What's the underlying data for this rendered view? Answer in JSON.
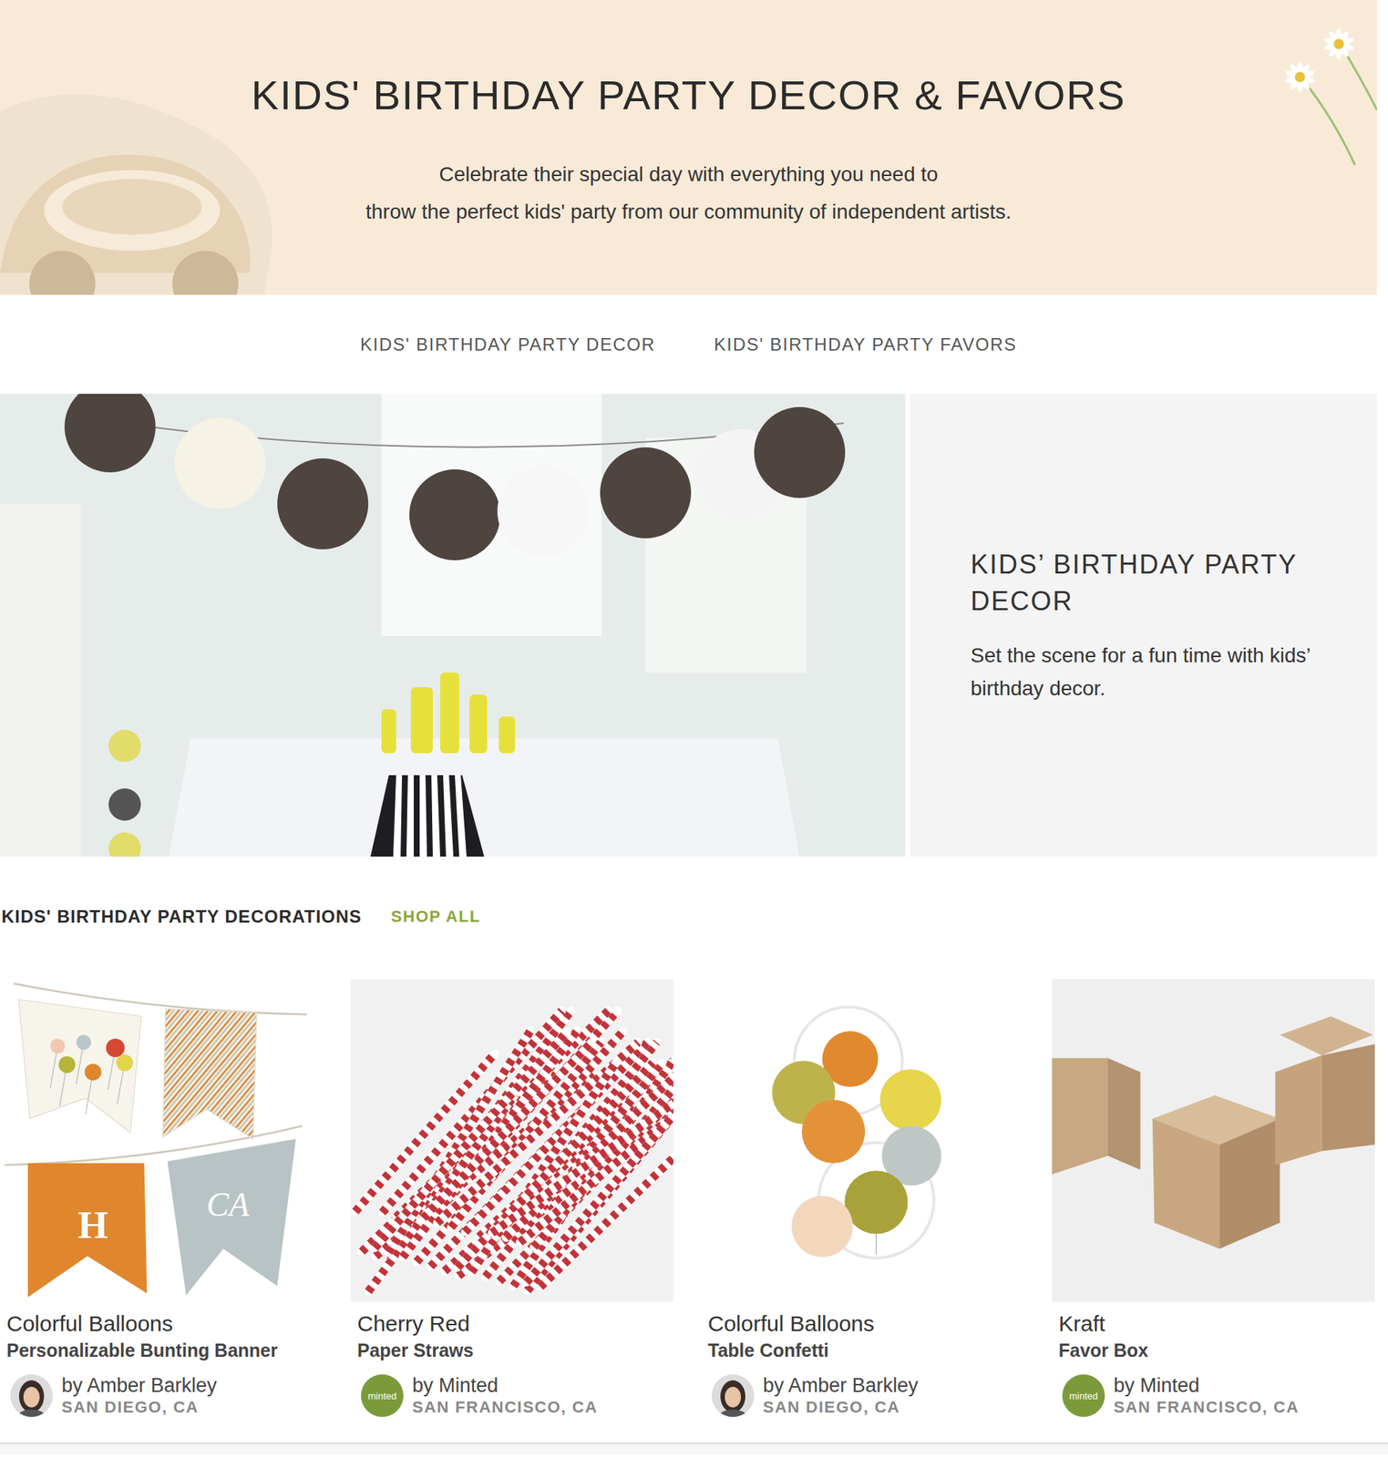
{
  "hero": {
    "title": "KIDS' BIRTHDAY PARTY DECOR & FAVORS",
    "subtitle_lines": [
      "Celebrate their special day with everything you need to",
      "throw the perfect kids' party from our community of independent artists."
    ]
  },
  "nav": [
    {
      "label": "KIDS' BIRTHDAY PARTY DECOR"
    },
    {
      "label": "KIDS' BIRTHDAY PARTY FAVORS"
    }
  ],
  "feature": {
    "title": "KIDS’ BIRTHDAY PARTY DECOR",
    "description": "Set the scene for a fun time with kids’ birthday decor."
  },
  "section": {
    "title": "KIDS' BIRTHDAY PARTY DECORATIONS",
    "link": "SHOP ALL"
  },
  "products": [
    {
      "kind": "bunting",
      "design": "Colorful Balloons",
      "type": "Personalizable Bunting Banner",
      "image_text": [
        "H",
        "CA"
      ],
      "seller": "by Amber Barkley",
      "location": "SAN DIEGO, CA",
      "avatar_kind": "photo"
    },
    {
      "kind": "straws",
      "design": "Cherry Red",
      "type": "Paper Straws",
      "seller": "by Minted",
      "location": "SAN FRANCISCO, CA",
      "avatar_kind": "logo",
      "avatar_text": "minted"
    },
    {
      "kind": "confetti",
      "design": "Colorful Balloons",
      "type": "Table Confetti",
      "seller": "by Amber Barkley",
      "location": "SAN DIEGO, CA",
      "avatar_kind": "photo"
    },
    {
      "kind": "boxes",
      "design": "Kraft",
      "type": "Favor Box",
      "seller": "by Minted",
      "location": "SAN FRANCISCO, CA",
      "avatar_kind": "logo",
      "avatar_text": "minted"
    }
  ]
}
